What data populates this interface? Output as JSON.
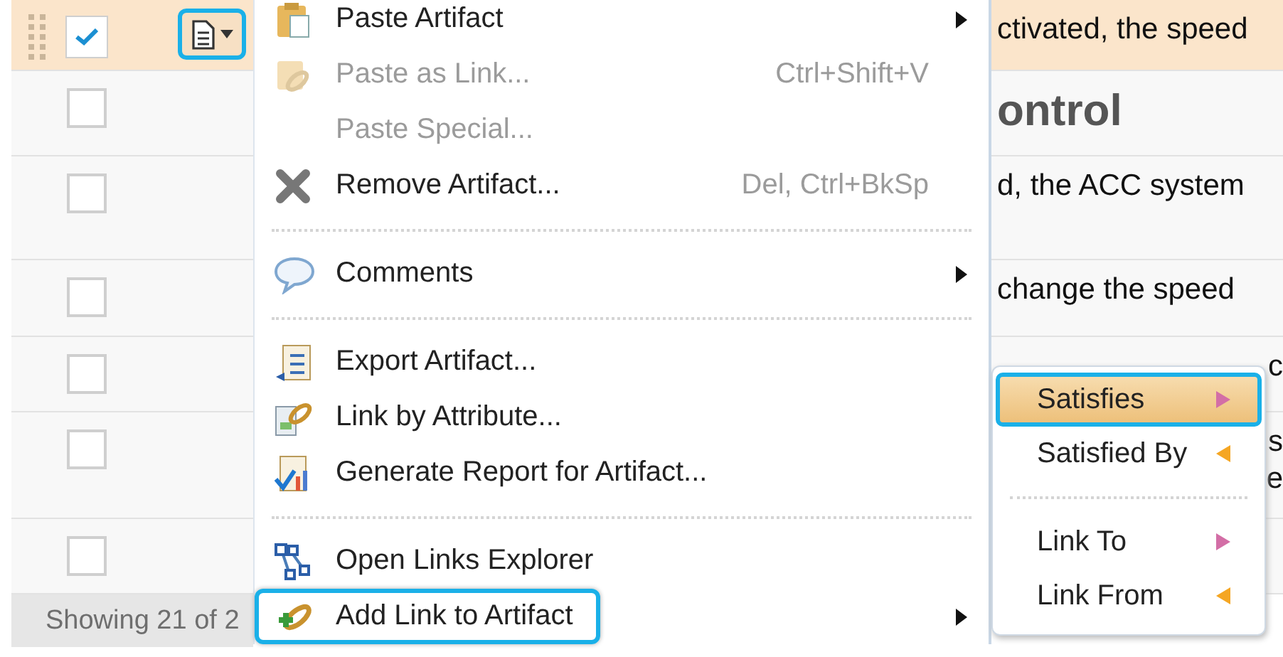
{
  "table": {
    "rows": [
      {
        "selected": true,
        "checked": true,
        "lines": [
          "ctivated, the speed"
        ],
        "kind": "text"
      },
      {
        "selected": false,
        "checked": false,
        "lines": [
          "ontrol"
        ],
        "kind": "heading"
      },
      {
        "selected": false,
        "checked": false,
        "lines": [
          "d, the ACC system"
        ],
        "kind": "text"
      },
      {
        "selected": false,
        "checked": false,
        "lines": [
          "change the speed"
        ],
        "kind": "text"
      },
      {
        "selected": false,
        "checked": false,
        "lines": [
          "c"
        ],
        "kind": "fragment"
      },
      {
        "selected": false,
        "checked": false,
        "lines": [
          "s",
          "e"
        ],
        "kind": "fragment"
      },
      {
        "selected": false,
        "checked": false
      }
    ],
    "footer": "Showing 21 of 2"
  },
  "context_menu": {
    "items": [
      {
        "kind": "item",
        "label": "Paste Artifact",
        "disabled": false,
        "submenu": true,
        "highlighted": false
      },
      {
        "kind": "item",
        "label": "Paste as Link...",
        "shortcut": "Ctrl+Shift+V",
        "disabled": true,
        "submenu": false,
        "highlighted": false
      },
      {
        "kind": "item",
        "label": "Paste Special...",
        "disabled": true,
        "submenu": false,
        "highlighted": false
      },
      {
        "kind": "item",
        "label": "Remove Artifact...",
        "shortcut": "Del, Ctrl+BkSp",
        "disabled": false,
        "submenu": false,
        "highlighted": false
      },
      {
        "kind": "separator"
      },
      {
        "kind": "item",
        "label": "Comments",
        "disabled": false,
        "submenu": true,
        "highlighted": false
      },
      {
        "kind": "separator"
      },
      {
        "kind": "item",
        "label": "Export Artifact...",
        "disabled": false,
        "submenu": false,
        "highlighted": false
      },
      {
        "kind": "item",
        "label": "Link by Attribute...",
        "disabled": false,
        "submenu": false,
        "highlighted": false
      },
      {
        "kind": "item",
        "label": "Generate Report for Artifact...",
        "disabled": false,
        "submenu": false,
        "highlighted": false
      },
      {
        "kind": "separator"
      },
      {
        "kind": "item",
        "label": "Open Links Explorer",
        "disabled": false,
        "submenu": false,
        "highlighted": false
      },
      {
        "kind": "item",
        "label": "Add Link to Artifact",
        "disabled": false,
        "submenu": true,
        "highlighted": true
      }
    ]
  },
  "submenu": {
    "items": [
      {
        "kind": "outgoing",
        "label": "Satisfies",
        "selected": true,
        "color": "#d36ea6"
      },
      {
        "kind": "incoming",
        "label": "Satisfied By",
        "selected": false,
        "color": "#f5a623"
      },
      {
        "kind": "separator"
      },
      {
        "kind": "outgoing",
        "label": "Link To",
        "selected": false,
        "color": "#d36ea6"
      },
      {
        "kind": "incoming",
        "label": "Link From",
        "selected": false,
        "color": "#f5a623"
      }
    ]
  }
}
